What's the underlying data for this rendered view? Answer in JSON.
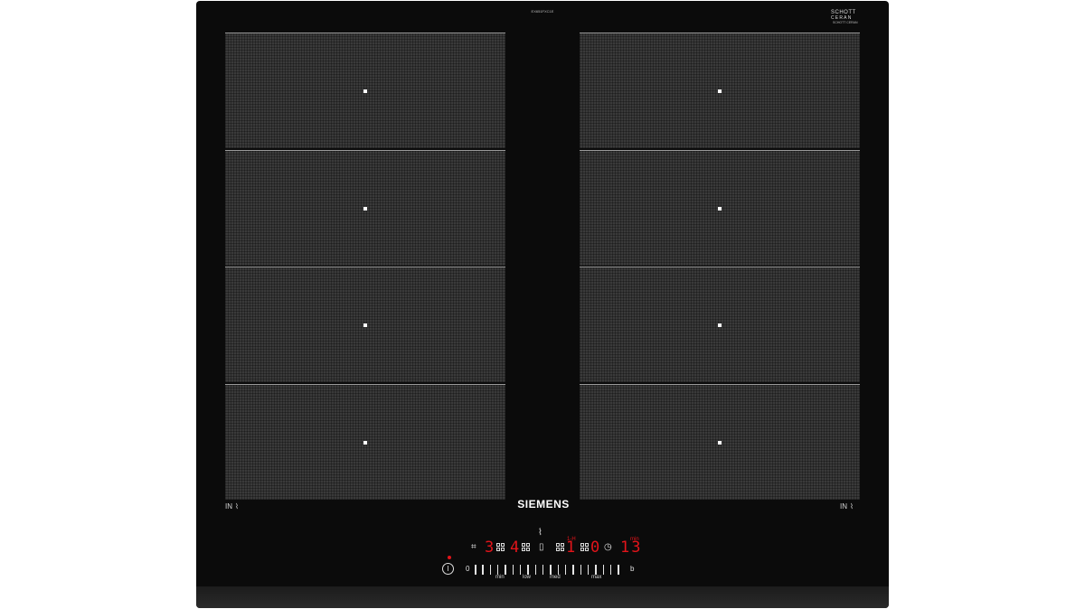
{
  "header": {
    "model": "EX651FXC1E",
    "glass_brand_line1": "SCHOTT",
    "glass_brand_line2": "CERAN",
    "glass_sub": "SCHOTT CERAN"
  },
  "brand": "SIEMENS",
  "zones": {
    "left": [
      "zone-1",
      "zone-2",
      "zone-3",
      "zone-4"
    ],
    "right": [
      "zone-1",
      "zone-2",
      "zone-3",
      "zone-4"
    ]
  },
  "in_label": "IN",
  "controls": {
    "digit_left_1": "3",
    "digit_left_2": "4",
    "digit_mid": "1",
    "digit_mid_2": "0",
    "timer_digits": "13",
    "timer_unit": "min",
    "mid_badge": "1-H",
    "slider_zero": "0",
    "slider_labels": {
      "min": "min",
      "low": "low",
      "med": "med",
      "max": "max"
    },
    "b_label": "b",
    "power_symbol": "I",
    "icons": [
      "flex-zone-icon",
      "pan-icon",
      "timer-icon"
    ]
  },
  "colors": {
    "display_red": "#e3141a",
    "glass": "#0b0b0b",
    "zone": "#3a3a3a"
  }
}
